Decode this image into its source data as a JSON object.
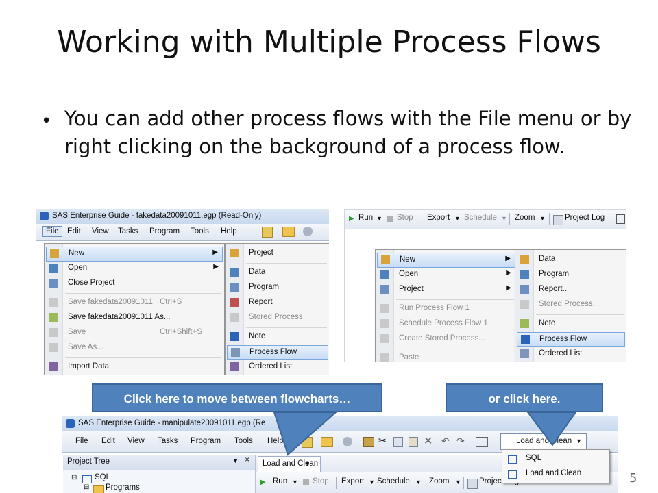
{
  "slide": {
    "title": "Working with Multiple Process Flows",
    "bullet": "You can add other process flows with the File menu or by right clicking on the background of a process flow.",
    "page_number": "5"
  },
  "shot1": {
    "window_title": "SAS Enterprise Guide - fakedata20091011.egp (Read-Only)",
    "menus": [
      "File",
      "Edit",
      "View",
      "Tasks",
      "Program",
      "Tools",
      "Help"
    ],
    "file_menu": [
      {
        "label": "New",
        "shortcut": "",
        "submenu": true,
        "highlight": true,
        "disabled": false
      },
      {
        "label": "Open",
        "shortcut": "",
        "submenu": true,
        "highlight": false,
        "disabled": false
      },
      {
        "label": "Close Project",
        "shortcut": "",
        "submenu": false,
        "highlight": false,
        "disabled": false
      },
      {
        "label": "Save fakedata20091011",
        "shortcut": "Ctrl+S",
        "submenu": false,
        "highlight": false,
        "disabled": true
      },
      {
        "label": "Save fakedata20091011 As...",
        "shortcut": "",
        "submenu": false,
        "highlight": false,
        "disabled": false
      },
      {
        "label": "Save",
        "shortcut": "Ctrl+Shift+S",
        "submenu": false,
        "highlight": false,
        "disabled": true
      },
      {
        "label": "Save As...",
        "shortcut": "",
        "submenu": false,
        "highlight": false,
        "disabled": true
      },
      {
        "label": "Import Data",
        "shortcut": "",
        "submenu": false,
        "highlight": false,
        "disabled": false
      }
    ],
    "new_submenu": [
      {
        "label": "Project",
        "highlight": false,
        "disabled": false
      },
      {
        "label": "Data",
        "highlight": false,
        "disabled": false
      },
      {
        "label": "Program",
        "highlight": false,
        "disabled": false
      },
      {
        "label": "Report",
        "highlight": false,
        "disabled": false
      },
      {
        "label": "Stored Process",
        "highlight": false,
        "disabled": true
      },
      {
        "label": "Note",
        "highlight": false,
        "disabled": false
      },
      {
        "label": "Process Flow",
        "highlight": true,
        "disabled": false
      },
      {
        "label": "Ordered List",
        "highlight": false,
        "disabled": false
      }
    ]
  },
  "shot2": {
    "toolbar": [
      "Run",
      "Stop",
      "Export",
      "Schedule",
      "Zoom",
      "Project Log"
    ],
    "context_menu": [
      {
        "label": "New",
        "submenu": true,
        "highlight": true,
        "disabled": false
      },
      {
        "label": "Open",
        "submenu": true,
        "highlight": false,
        "disabled": false
      },
      {
        "label": "Project",
        "submenu": true,
        "highlight": false,
        "disabled": false
      },
      {
        "label": "Run Process Flow 1",
        "submenu": false,
        "highlight": false,
        "disabled": true
      },
      {
        "label": "Schedule Process Flow 1",
        "submenu": false,
        "highlight": false,
        "disabled": true
      },
      {
        "label": "Create Stored Process...",
        "submenu": false,
        "highlight": false,
        "disabled": true
      },
      {
        "label": "Paste",
        "submenu": false,
        "highlight": false,
        "disabled": true
      }
    ],
    "new_submenu": [
      {
        "label": "Data",
        "highlight": false,
        "disabled": false
      },
      {
        "label": "Program",
        "highlight": false,
        "disabled": false
      },
      {
        "label": "Report...",
        "highlight": false,
        "disabled": false
      },
      {
        "label": "Stored Process...",
        "highlight": false,
        "disabled": true
      },
      {
        "label": "Note",
        "highlight": false,
        "disabled": false
      },
      {
        "label": "Process Flow",
        "highlight": true,
        "disabled": false
      },
      {
        "label": "Ordered List",
        "highlight": false,
        "disabled": false
      }
    ]
  },
  "callouts": {
    "left": "Click here to move between flowcharts…",
    "right": "or click here."
  },
  "shot3": {
    "window_title": "SAS Enterprise Guide - manipulate20091011.egp (Re",
    "menus": [
      "File",
      "Edit",
      "View",
      "Tasks",
      "Program",
      "Tools",
      "Help"
    ],
    "flow_dropdown": "Load and Clean",
    "dropdown_items": [
      "SQL",
      "Load and Clean"
    ],
    "project_tree_title": "Project Tree",
    "tree_items": [
      "SQL",
      "Programs"
    ],
    "tab_label": "Load and Clean",
    "toolbar": [
      "Run",
      "Stop",
      "Export",
      "Schedule",
      "Zoom",
      "Project Log"
    ]
  },
  "colors": {
    "callout": "#4f81bd",
    "highlight": "#c7dcf6"
  }
}
